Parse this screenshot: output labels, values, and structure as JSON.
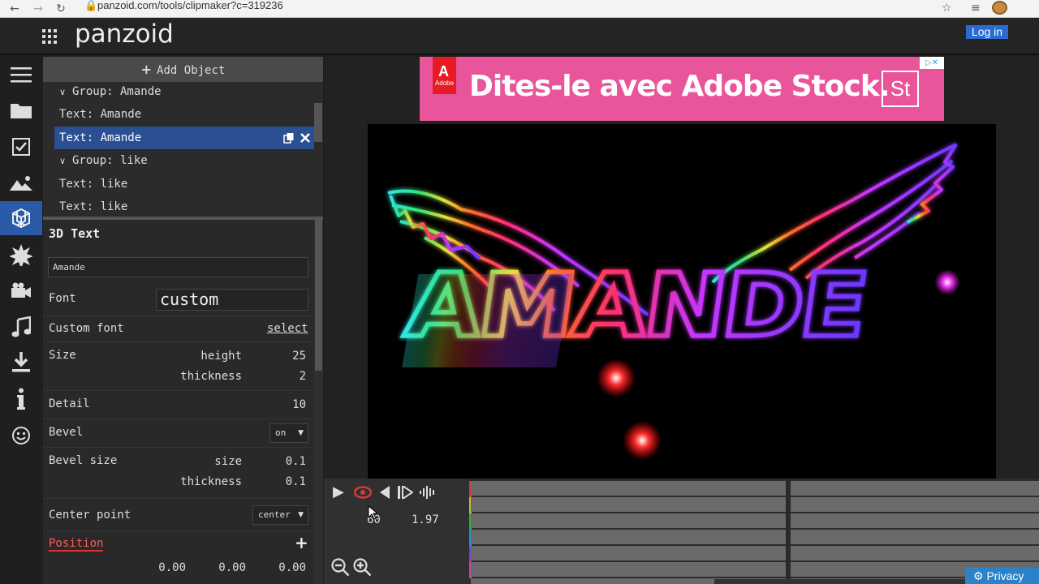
{
  "browser": {
    "url": "panzoid.com/tools/clipmaker?c=319236"
  },
  "header": {
    "logo": "panzoid",
    "login_label": "Log in"
  },
  "sidebar": {
    "icons": [
      "menu-icon",
      "folder-icon",
      "checkbox-icon",
      "image-icon",
      "3d-box-icon",
      "burst-icon",
      "camera-icon",
      "music-icon",
      "download-icon",
      "info-icon",
      "smiley-icon"
    ],
    "active": "3d-box-icon"
  },
  "objects": {
    "add_label": "Add Object",
    "items": [
      {
        "label": "Group: Amande",
        "type": "group"
      },
      {
        "label": "Text: Amande",
        "type": "item"
      },
      {
        "label": "Text: Amande",
        "type": "item",
        "selected": true
      },
      {
        "label": "Group: like",
        "type": "group"
      },
      {
        "label": "Text: like",
        "type": "item"
      },
      {
        "label": "Text: like",
        "type": "item"
      }
    ]
  },
  "properties": {
    "title": "3D Text",
    "text_value": "Amande",
    "font_label": "Font",
    "font_value": "custom",
    "custom_font_label": "Custom font",
    "custom_font_link": "select",
    "size_label": "Size",
    "height_label": "height",
    "height_value": "25",
    "thickness_label": "thickness",
    "thickness_value": "2",
    "detail_label": "Detail",
    "detail_value": "10",
    "bevel_label": "Bevel",
    "bevel_value": "on",
    "bevel_size_label": "Bevel size",
    "bevel_size_size_label": "size",
    "bevel_size_size_value": "0.1",
    "bevel_size_thickness_label": "thickness",
    "bevel_size_thickness_value": "0.1",
    "center_label": "Center point",
    "center_value": "center",
    "position_label": "Position",
    "position_x": "0.00",
    "position_y": "0.00",
    "position_z": "0.00"
  },
  "ad": {
    "brand": "Adobe",
    "text": "Dites-le avec Adobe Stock.",
    "product_badge": "St"
  },
  "preview": {
    "title_text": "AMANDE"
  },
  "timeline": {
    "fps": "60",
    "time": "1.97",
    "track_colors": [
      "#d63a3a",
      "#c9b933",
      "#3aa84a",
      "#2e8fd1",
      "#7a46c9",
      "#c946a6"
    ]
  },
  "footer": {
    "privacy_label": "Privacy"
  }
}
